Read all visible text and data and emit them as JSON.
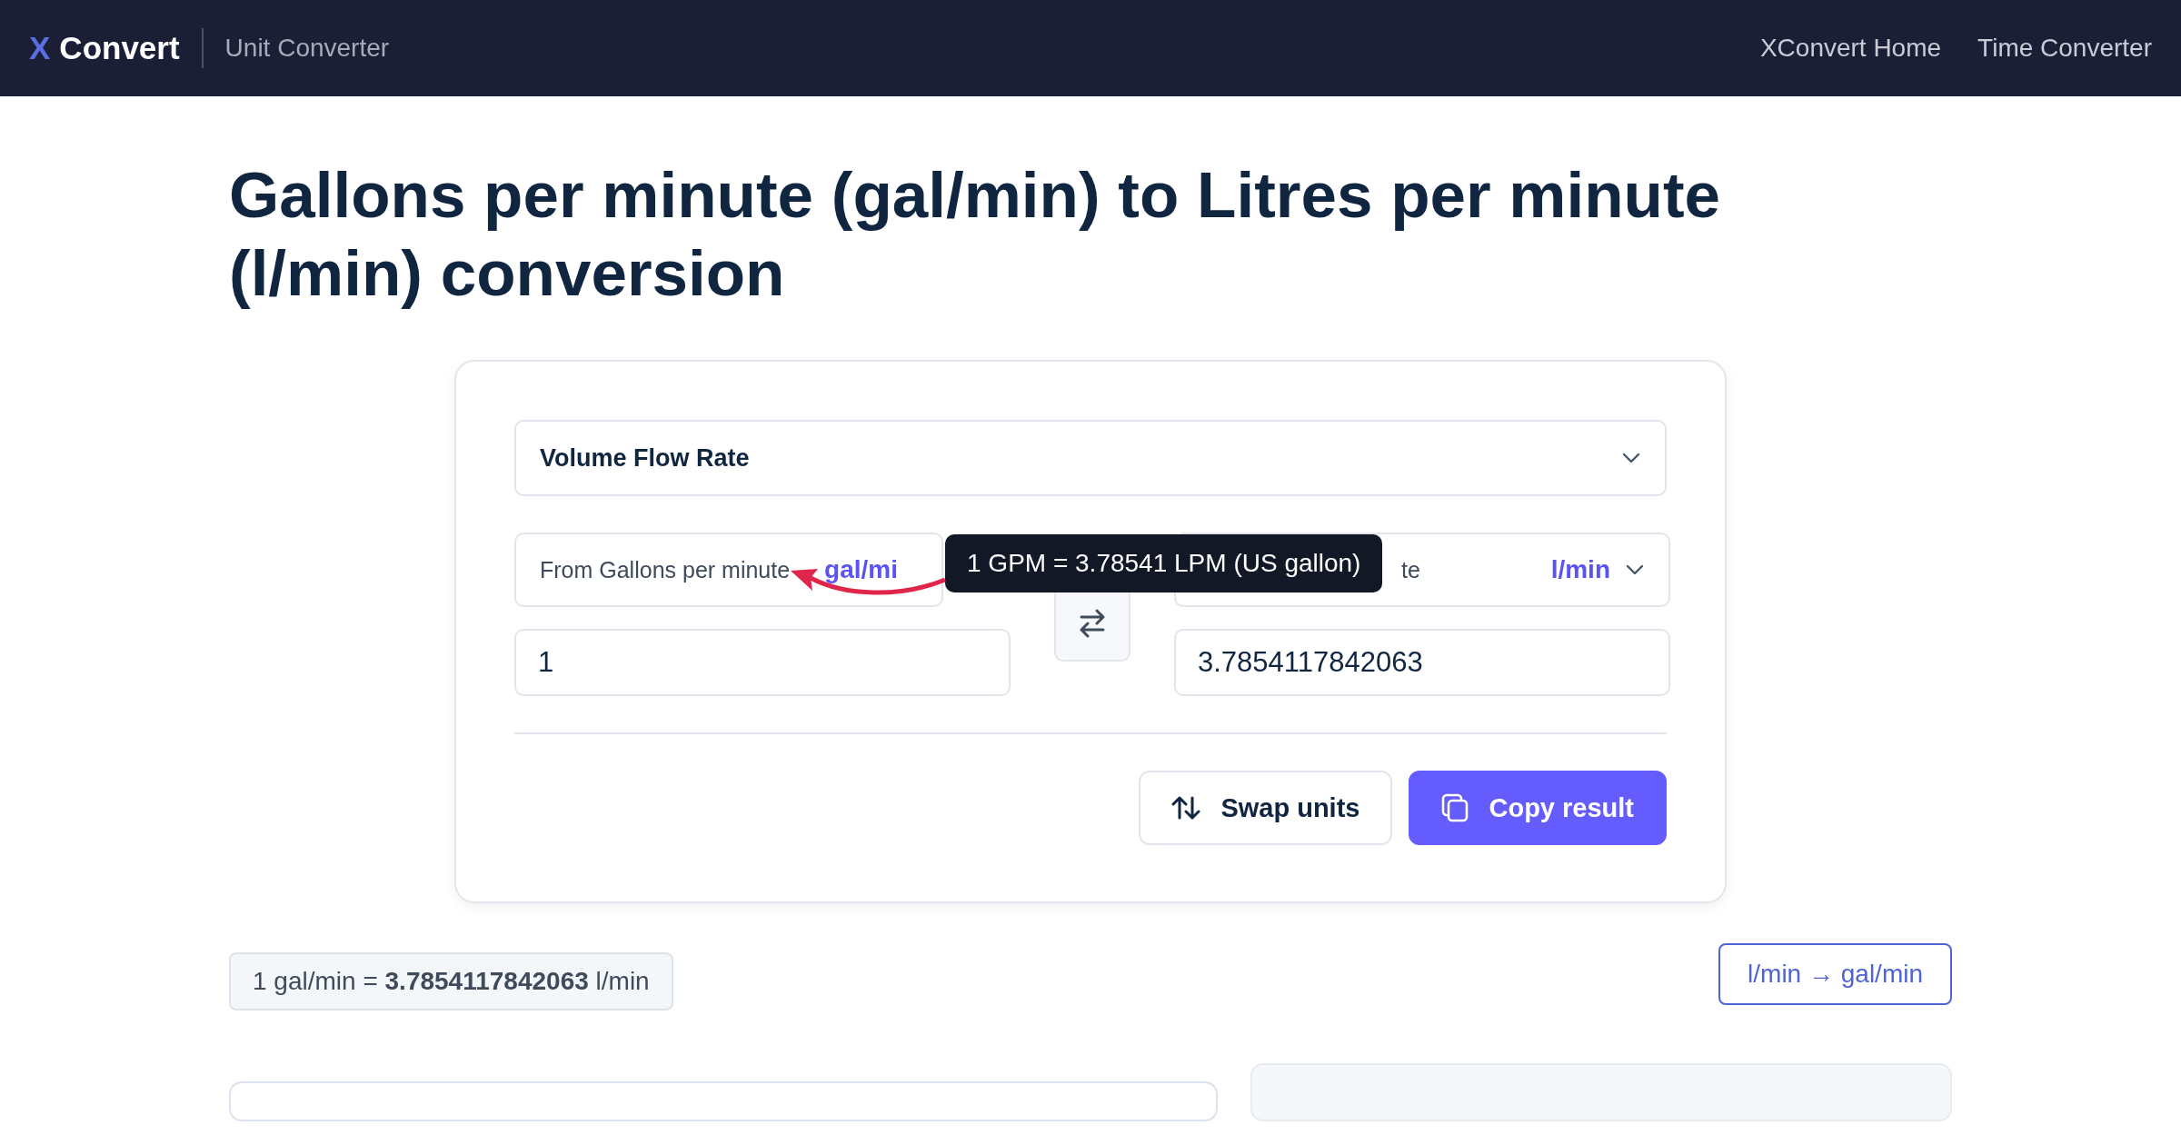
{
  "header": {
    "logo_mark": "X",
    "logo_text": "Convert",
    "section": "Unit Converter",
    "links": [
      "XConvert Home",
      "Time Converter"
    ]
  },
  "title": "Gallons per minute (gal/min) to Litres per minute (l/min) conversion",
  "converter": {
    "category": "Volume Flow Rate",
    "from": {
      "label": "From Gallons per minute",
      "unit": "gal/mi",
      "value": "1"
    },
    "to": {
      "label": "te",
      "unit": "l/min",
      "value": "3.7854117842063"
    },
    "tooltip": "1 GPM = 3.78541 LPM (US gallon)",
    "buttons": [
      {
        "kind": "secondary",
        "label": "Swap units"
      },
      {
        "kind": "primary",
        "label": "Copy result"
      }
    ]
  },
  "summary": "1 gal/min = **3.7854117842063** l/min",
  "reverse_link": "l/min → gal/min"
}
